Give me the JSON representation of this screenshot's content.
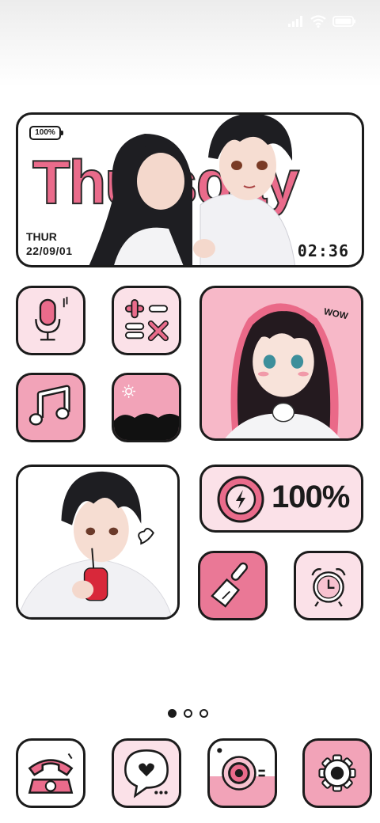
{
  "status_bar": {
    "icons": [
      "signal-icon",
      "wifi-icon",
      "battery-icon"
    ]
  },
  "hero_widget": {
    "battery_label": "100%",
    "day_word": "Thursday",
    "day_short": "THUR",
    "date": "22/09/01",
    "time": "02:36"
  },
  "apps": {
    "recorder_icon": "microphone-icon",
    "calculator_icon": "calculator-icon",
    "music_icon": "music-note-icon",
    "weather_icon": "weather-icon",
    "cleaner_icon": "brush-icon",
    "clock_icon": "alarm-clock-icon"
  },
  "battery_widget": {
    "percent": "100%",
    "icon": "bolt-icon"
  },
  "page_indicator": {
    "count": 3,
    "active_index": 0
  },
  "dock": {
    "items": [
      "phone-icon",
      "messages-icon",
      "camera-icon",
      "settings-icon"
    ]
  },
  "colors": {
    "accent_pink": "#ea6b8b",
    "tile_pink": "#f2a3b8",
    "tile_light": "#fbe1e8",
    "outline": "#1b1b1b"
  }
}
